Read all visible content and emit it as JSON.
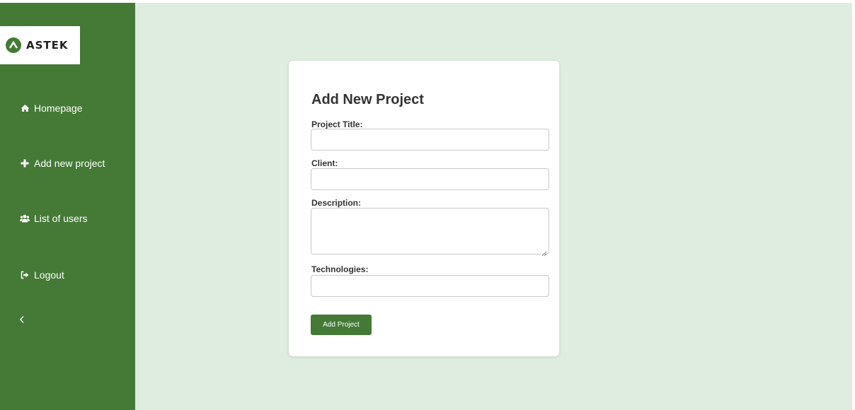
{
  "brand": {
    "name": "ASTEK"
  },
  "sidebar": {
    "items": [
      {
        "label": "Homepage",
        "icon": "home-icon"
      },
      {
        "label": "Add new project",
        "icon": "plus-icon"
      },
      {
        "label": "List of users",
        "icon": "users-icon"
      },
      {
        "label": "Logout",
        "icon": "logout-icon"
      }
    ],
    "collapse_icon": "chevron-left-icon"
  },
  "form": {
    "title": "Add New Project",
    "fields": {
      "project_title": {
        "label": "Project Title:",
        "value": "",
        "placeholder": ""
      },
      "client": {
        "label": "Client:",
        "value": "",
        "placeholder": ""
      },
      "description": {
        "label": "Description:",
        "value": "",
        "placeholder": ""
      },
      "technologies": {
        "label": "Technologies:",
        "value": "",
        "placeholder": ""
      }
    },
    "submit_label": "Add Project"
  },
  "colors": {
    "sidebar_bg": "#447a36",
    "main_bg": "#deedde",
    "accent": "#447a36",
    "card_bg": "#ffffff"
  }
}
